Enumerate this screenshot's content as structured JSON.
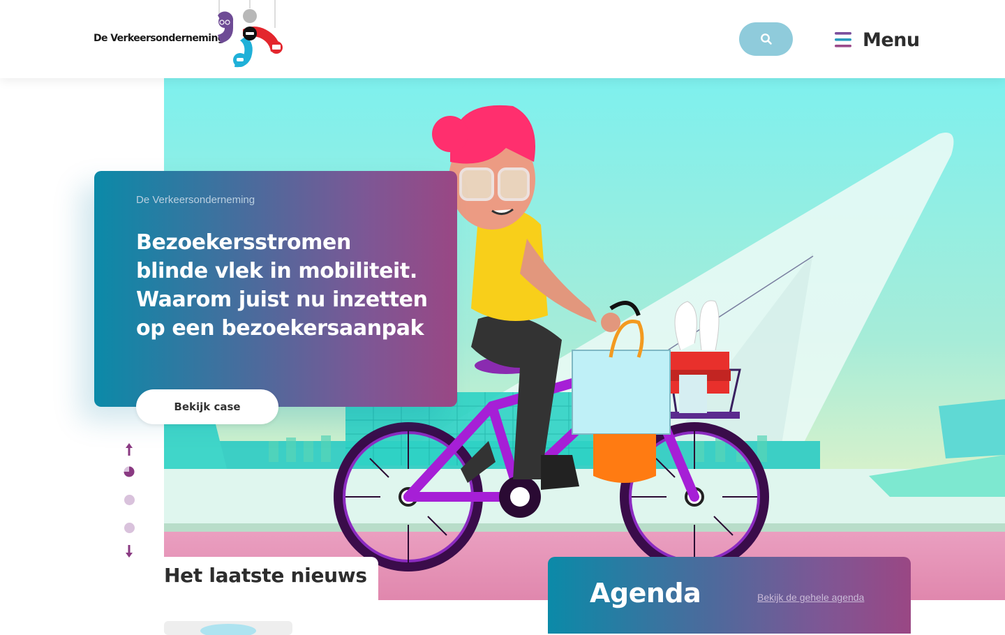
{
  "brand": {
    "name": "De Verkeersonderneming"
  },
  "header": {
    "search_icon": "search-icon",
    "menu_icon": "hamburger-icon",
    "menu_label": "Menu"
  },
  "hero": {
    "kicker": "De Verkeersonderneming",
    "title": "Bezoekersstromen blinde vlek in mobiliteit. Waarom juist nu inzetten op een bezoekersaanpak",
    "cta_label": "Bekijk case"
  },
  "slider": {
    "up_icon": "arrow-up-icon",
    "down_icon": "arrow-down-icon",
    "slide_count": 3,
    "active_slide": 1
  },
  "news": {
    "title": "Het laatste nieuws"
  },
  "agenda": {
    "title": "Agenda",
    "link_label": "Bekijk de gehele agenda"
  },
  "colors": {
    "gradient_start": "#0b8aa8",
    "gradient_end": "#9a4784",
    "search_bg": "#8fcbdb",
    "nav_accent": "#8a3a82",
    "nav_dot": "#d9c2dc"
  }
}
